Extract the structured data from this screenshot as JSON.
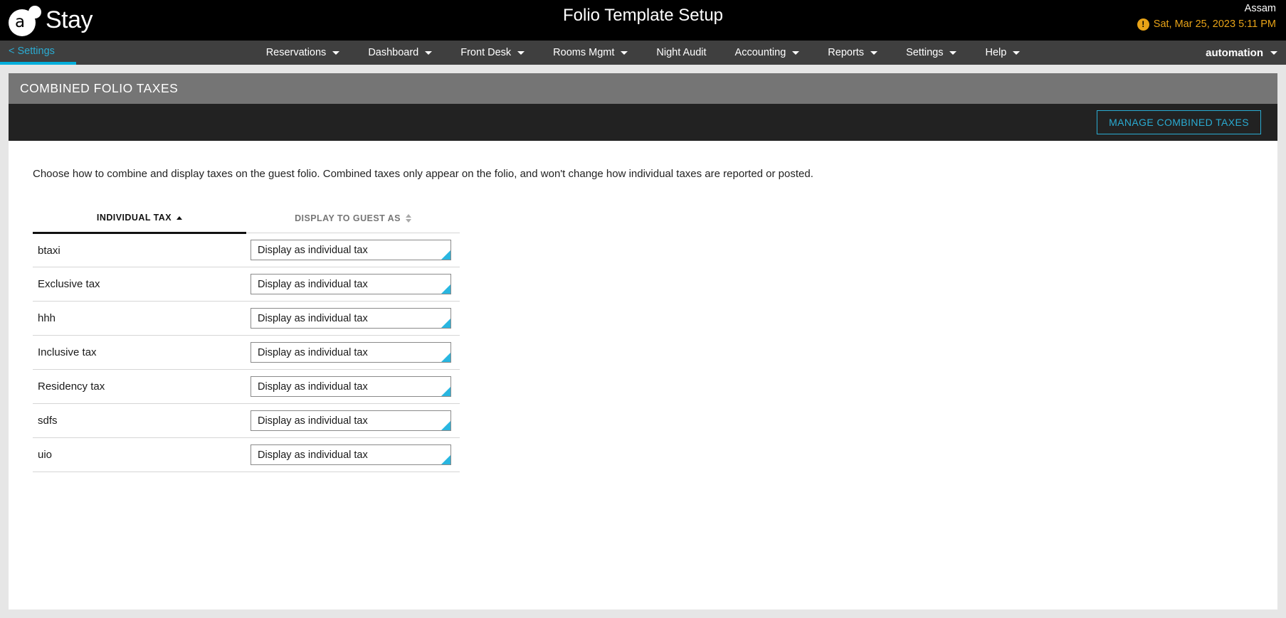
{
  "topbar": {
    "logo_text": "Stay",
    "logo_letter": "a",
    "page_title": "Folio Template Setup",
    "property_name": "Assam",
    "datetime": "Sat, Mar 25, 2023 5:11 PM",
    "warn_glyph": "!"
  },
  "nav": {
    "back_label": "< Settings",
    "items": [
      {
        "label": "Reservations",
        "has_caret": true
      },
      {
        "label": "Dashboard",
        "has_caret": true
      },
      {
        "label": "Front Desk",
        "has_caret": true
      },
      {
        "label": "Rooms Mgmt",
        "has_caret": true
      },
      {
        "label": "Night Audit",
        "has_caret": false
      },
      {
        "label": "Accounting",
        "has_caret": true
      },
      {
        "label": "Reports",
        "has_caret": true
      },
      {
        "label": "Settings",
        "has_caret": true
      },
      {
        "label": "Help",
        "has_caret": true
      }
    ],
    "user_label": "automation"
  },
  "panel": {
    "header_title": "COMBINED FOLIO TAXES",
    "manage_button": "MANAGE COMBINED TAXES",
    "description": "Choose how to combine and display taxes on the guest folio. Combined taxes only appear on the folio, and won't change how individual taxes are reported or posted."
  },
  "table": {
    "columns": [
      {
        "label": "INDIVIDUAL TAX",
        "sort": "asc"
      },
      {
        "label": "DISPLAY TO GUEST AS",
        "sort": "none"
      }
    ],
    "rows": [
      {
        "tax": "btaxi",
        "display": "Display as individual tax"
      },
      {
        "tax": "Exclusive tax",
        "display": "Display as individual tax"
      },
      {
        "tax": "hhh",
        "display": "Display as individual tax"
      },
      {
        "tax": "Inclusive tax",
        "display": "Display as individual tax"
      },
      {
        "tax": "Residency tax",
        "display": "Display as individual tax"
      },
      {
        "tax": "sdfs",
        "display": "Display as individual tax"
      },
      {
        "tax": "uio",
        "display": "Display as individual tax"
      }
    ],
    "select_options": [
      "Display as individual tax"
    ]
  },
  "colors": {
    "accent_cyan": "#00aedb",
    "link_cyan": "#2aabd2",
    "warn_amber": "#e8a317",
    "nav_bg": "#3f3f3f",
    "panel_header_bg": "#757575",
    "action_bar_bg": "#222222"
  }
}
